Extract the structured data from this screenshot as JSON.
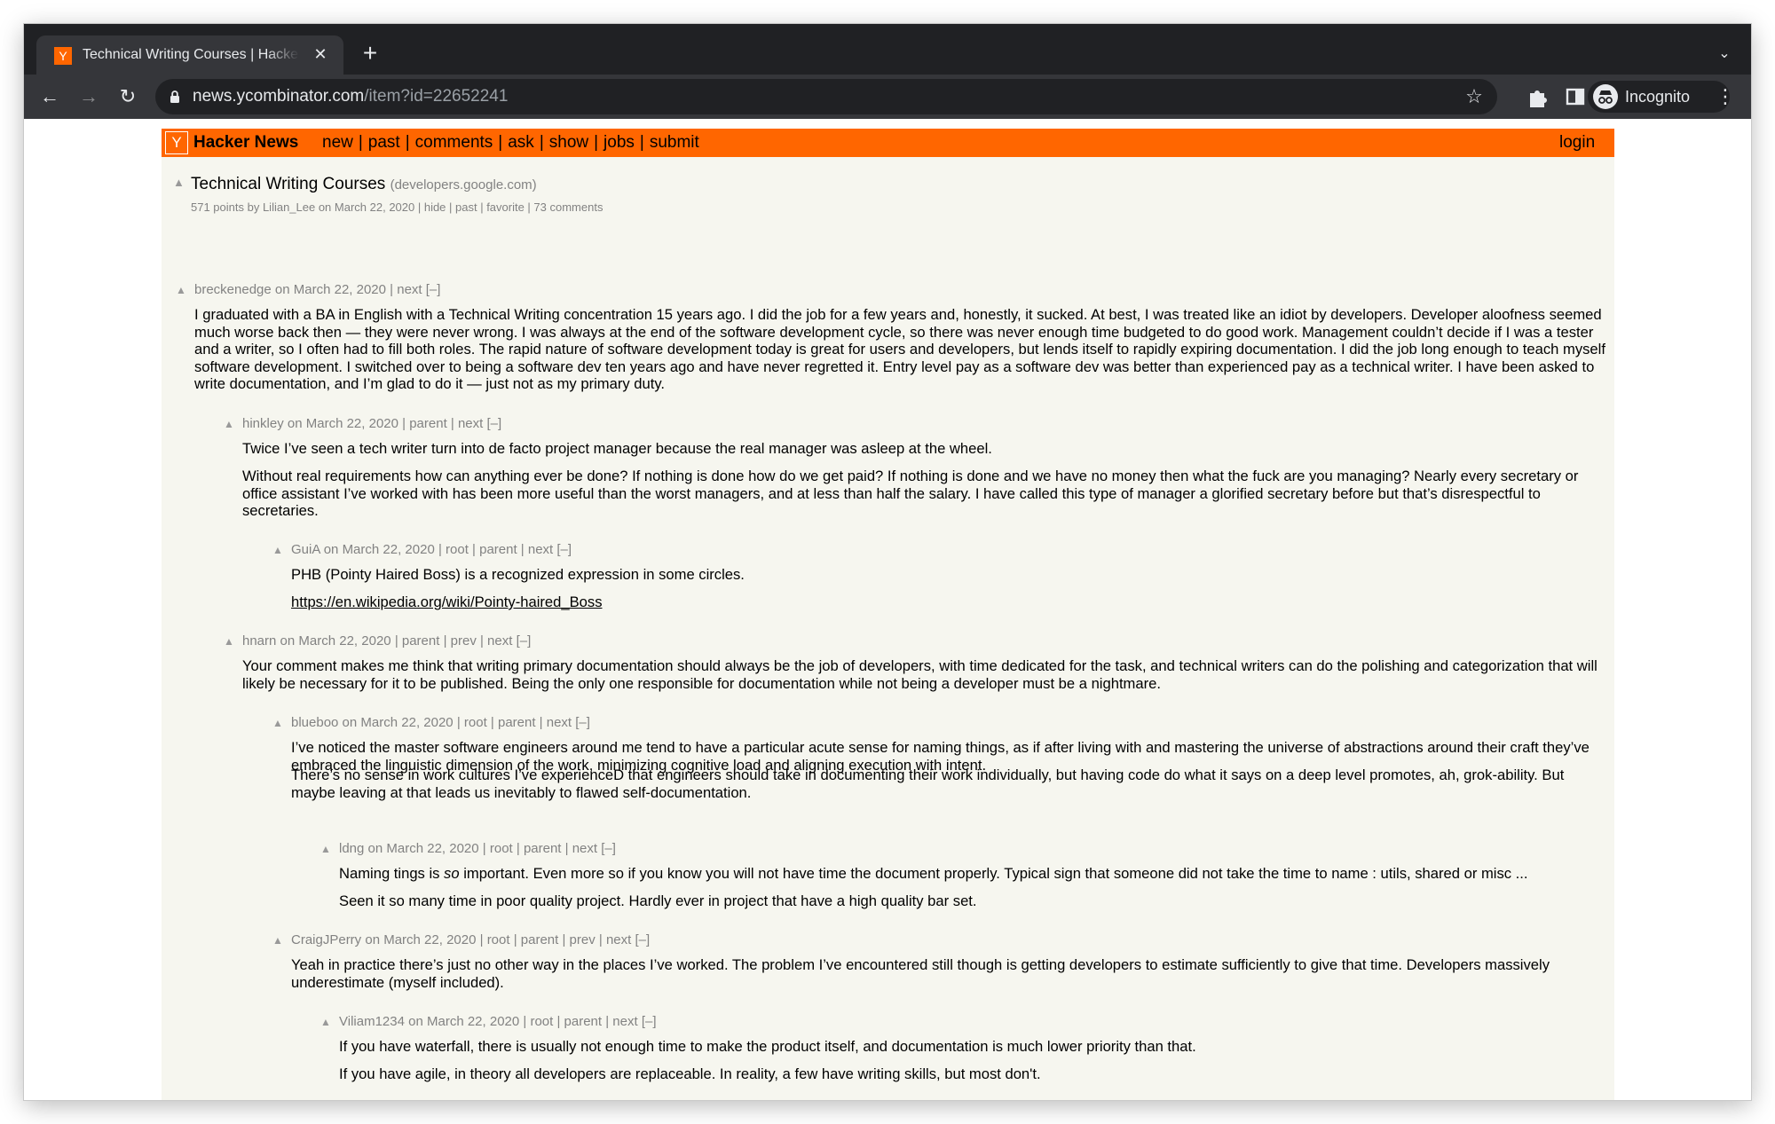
{
  "browser": {
    "tab_title": "Technical Writing Courses | Hacker News",
    "tab_favicon": "Y",
    "url_host": "news.ycombinator.com",
    "url_path": "/item?id=22652241",
    "profile_label": "Incognito"
  },
  "hn": {
    "logo": "Y",
    "site_name": "Hacker News",
    "nav": [
      "new",
      "past",
      "comments",
      "ask",
      "show",
      "jobs",
      "submit"
    ],
    "login": "login",
    "accent_color": "#ff6600"
  },
  "story": {
    "title": "Technical Writing Courses",
    "site": "(developers.google.com)",
    "subtext": "571 points by Lilian_Lee on March 22, 2020 | hide | past | favorite | 73 comments"
  },
  "comments": [
    {
      "depth": 0,
      "user": "breckenedge",
      "age": "March 22, 2020",
      "links": "| next [–]",
      "paragraphs": [
        "I graduated with a BA in English with a Technical Writing concentration 15 years ago. I did the job for a few years and, honestly, it sucked. At best, I was treated like an idiot by developers. Developer aloofness seemed much worse back then — they were never wrong. I was always at the end of the software development cycle, so there was never enough time budgeted to do good work. Management couldn’t decide if I was a tester and a writer, so I often had to fill both roles. The rapid nature of software development today is great for users and developers, but lends itself to rapidly expiring documentation. I did the job long enough to teach myself software development. I switched over to being a software dev ten years ago and have never regretted it. Entry level pay as a software dev was better than experienced pay as a technical writer. I have been asked to write documentation, and I’m glad to do it — just not as my primary duty."
      ]
    },
    {
      "depth": 1,
      "user": "hinkley",
      "age": "March 22, 2020",
      "links": "| parent | next [–]",
      "paragraphs": [
        "Twice I’ve seen a tech writer turn into de facto project manager because the real manager was asleep at the wheel.",
        "Without real requirements how can anything ever be done? If nothing is done how do we get paid? If nothing is done and we have no money then what the fuck are you managing? Nearly every secretary or office assistant I’ve worked with has been more useful than the worst managers, and at less than half the salary. I have called this type of manager a glorified secretary before but that’s disrespectful to secretaries."
      ]
    },
    {
      "depth": 2,
      "user": "GuiA",
      "age": "March 22, 2020",
      "links": "| root | parent | next [–]",
      "paragraphs": [
        "PHB (Pointy Haired Boss) is a recognized expression in some circles.",
        "https://en.wikipedia.org/wiki/Pointy-haired_Boss"
      ]
    },
    {
      "depth": 1,
      "user": "hnarn",
      "age": "March 22, 2020",
      "links": "| parent | prev | next [–]",
      "paragraphs": [
        "Your comment makes me think that writing primary documentation should always be the job of developers, with time dedicated for the task, and technical writers can do the polishing and categorization that will likely be necessary for it to be published. Being the only one responsible for documentation while not being a developer must be a nightmare."
      ]
    },
    {
      "depth": 2,
      "user": "blueboo",
      "age": "March 22, 2020",
      "links": "| root | parent | next [–]",
      "paragraphs": [
        "I’ve noticed the master software engineers around me tend to have a particular acute sense for naming things, as if after living with and mastering the universe of abstractions around their craft they’ve embraced the linguistic dimension of the work, minimizing cognitive load and aligning execution with intent.",
        "There’s no sense in work cultures I’ve experienceD that engineers should take in documenting their work individually, but having code do what it says on a deep level promotes, ah, grok-ability. But maybe leaving at that leads us inevitably to flawed self-documentation."
      ]
    },
    {
      "depth": 3,
      "user": "ldng",
      "age": "March 22, 2020",
      "links": "| root | parent | next [–]",
      "paragraphs_rich": {
        "p1_before": "Naming tings is ",
        "p1_italic": "so",
        "p1_after": " important. Even more so if you know you will not have time the document properly. Typical sign that someone did not take the time to name : utils, shared or misc ..."
      },
      "paragraphs": [
        "Seen it so many time in poor quality project. Hardly ever in project that have a high quality bar set."
      ]
    },
    {
      "depth": 2,
      "user": "CraigJPerry",
      "age": "March 22, 2020",
      "links": "| root | parent | prev | next [–]",
      "paragraphs": [
        "Yeah in practice there’s just no other way in the places I’ve worked. The problem I’ve encountered still though is getting developers to estimate sufficiently to give that time. Developers massively underestimate (myself included)."
      ]
    },
    {
      "depth": 3,
      "user": "Viliam1234",
      "age": "March 22, 2020",
      "links": "| root | parent | next [–]",
      "paragraphs": [
        "If you have waterfall, there is usually not enough time to make the product itself, and documentation is much lower priority than that.",
        "If you have agile, in theory all developers are replaceable. In reality, a few have writing skills, but most don't."
      ]
    }
  ]
}
